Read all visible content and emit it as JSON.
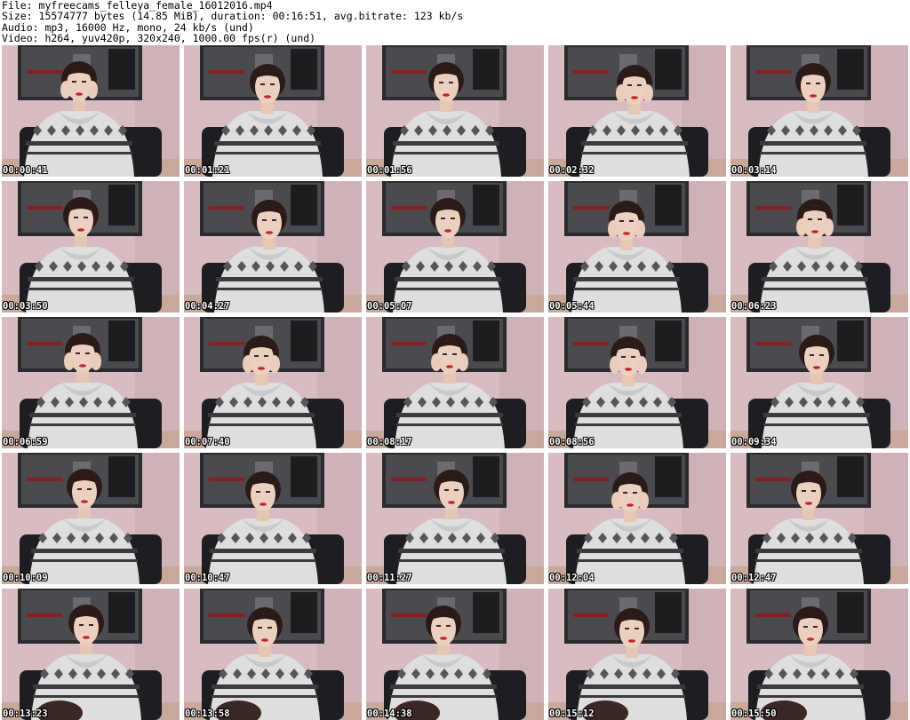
{
  "header": {
    "file_line": "File: myfreecams_felleya_female_16012016.mp4",
    "size_line": "Size: 15574777 bytes (14.85 MiB), duration: 00:16:51, avg.bitrate: 123 kb/s",
    "audio_line": "Audio: mp3, 16000 Hz, mono, 24 kb/s (und)",
    "video_line": "Video: h264, yuv420p, 320x240, 1000.00 fps(r) (und)"
  },
  "thumbnails": [
    {
      "time": "00:00:41"
    },
    {
      "time": "00:01:21"
    },
    {
      "time": "00:01:56"
    },
    {
      "time": "00:02:32"
    },
    {
      "time": "00:03:14"
    },
    {
      "time": "00:03:50"
    },
    {
      "time": "00:04:27"
    },
    {
      "time": "00:05:07"
    },
    {
      "time": "00:05:44"
    },
    {
      "time": "00:06:23"
    },
    {
      "time": "00:06:59"
    },
    {
      "time": "00:07:40"
    },
    {
      "time": "00:08:17"
    },
    {
      "time": "00:08:56"
    },
    {
      "time": "00:09:34"
    },
    {
      "time": "00:10:09"
    },
    {
      "time": "00:10:47"
    },
    {
      "time": "00:11:27"
    },
    {
      "time": "00:12:04"
    },
    {
      "time": "00:12:47"
    },
    {
      "time": "00:13:23"
    },
    {
      "time": "00:13:58"
    },
    {
      "time": "00:14:38"
    },
    {
      "time": "00:15:12"
    },
    {
      "time": "00:15:50"
    }
  ]
}
